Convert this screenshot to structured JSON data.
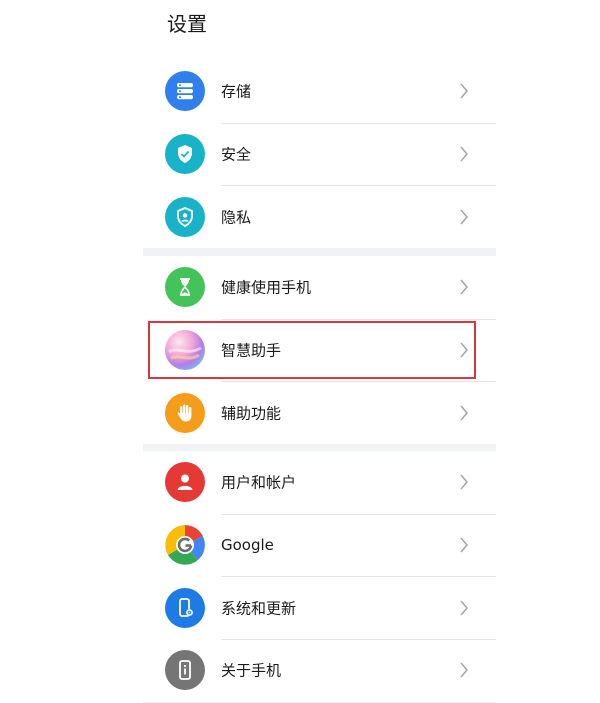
{
  "header": {
    "title": "设置"
  },
  "groups": [
    {
      "items": [
        {
          "label": "存储",
          "icon": "storage-icon",
          "color": "#2f80ed"
        },
        {
          "label": "安全",
          "icon": "security-shield-icon",
          "color": "#18b3c9"
        },
        {
          "label": "隐私",
          "icon": "privacy-shield-icon",
          "color": "#18b3c9"
        }
      ]
    },
    {
      "items": [
        {
          "label": "健康使用手机",
          "icon": "hourglass-icon",
          "color": "#43c35a"
        },
        {
          "label": "智慧助手",
          "icon": "assistant-orb-icon",
          "color": "#e8a9d8"
        },
        {
          "label": "辅助功能",
          "icon": "hand-icon",
          "color": "#f59c1a"
        }
      ]
    },
    {
      "items": [
        {
          "label": "用户和帐户",
          "icon": "user-icon",
          "color": "#e53935"
        },
        {
          "label": "Google",
          "icon": "google-icon",
          "color": "#4285f4"
        },
        {
          "label": "系统和更新",
          "icon": "phone-settings-icon",
          "color": "#1e7be6"
        },
        {
          "label": "关于手机",
          "icon": "phone-info-icon",
          "color": "#757575"
        }
      ]
    }
  ],
  "highlight_color": "#d7373f"
}
